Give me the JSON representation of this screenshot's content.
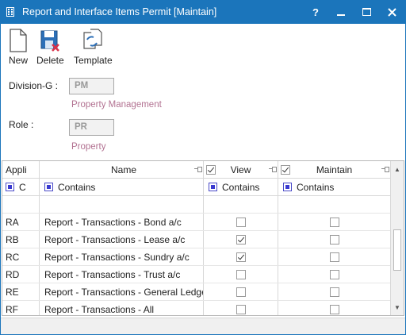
{
  "window": {
    "title": "Report and Interface Items Permit [Maintain]",
    "help_label": "?",
    "accent_color": "#1b75bb"
  },
  "toolbar": {
    "new_label": "New",
    "delete_label": "Delete",
    "template_label": "Template"
  },
  "form": {
    "division_label": "Division-G :",
    "division_code": "PM",
    "division_desc": "Property Management",
    "role_label": "Role :",
    "role_code": "PR",
    "role_desc": "Property"
  },
  "grid": {
    "headers": {
      "appli": "Appli",
      "name": "Name",
      "view": "View",
      "maintain": "Maintain"
    },
    "filters": {
      "appli": "C",
      "name": "Contains",
      "view": "Contains",
      "maintain": "Contains"
    },
    "rows": [
      {
        "code": "RA",
        "name": "Report - Transactions - Bond a/c",
        "view": false,
        "maintain": false
      },
      {
        "code": "RB",
        "name": "Report - Transactions - Lease a/c",
        "view": true,
        "maintain": false
      },
      {
        "code": "RC",
        "name": "Report - Transactions - Sundry a/c",
        "view": true,
        "maintain": false
      },
      {
        "code": "RD",
        "name": "Report - Transactions - Trust a/c",
        "view": false,
        "maintain": false
      },
      {
        "code": "RE",
        "name": "Report - Transactions - General Ledger",
        "view": false,
        "maintain": false
      },
      {
        "code": "RF",
        "name": "Report - Transactions - All",
        "view": false,
        "maintain": false
      }
    ]
  }
}
